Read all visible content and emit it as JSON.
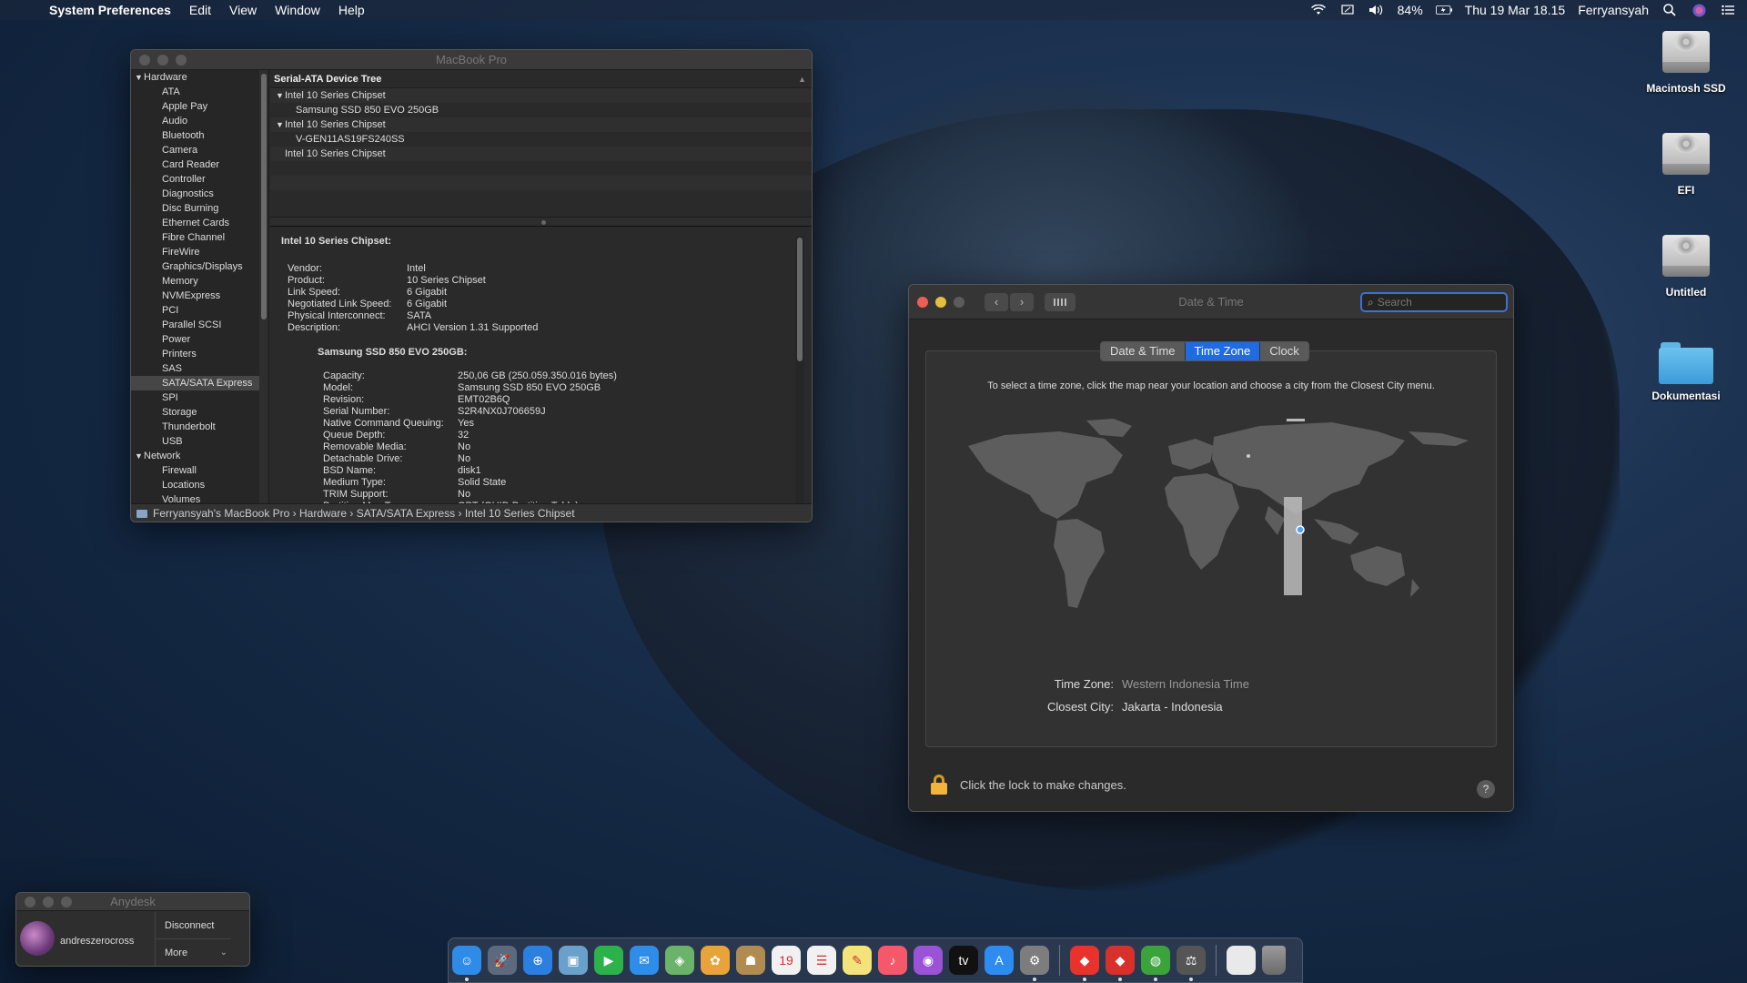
{
  "menubar": {
    "app_name": "System Preferences",
    "menus": [
      "Edit",
      "View",
      "Window",
      "Help"
    ],
    "battery": "84%",
    "clock": "Thu 19 Mar  18.15",
    "user": "Ferryansyah"
  },
  "sysinfo": {
    "title": "MacBook Pro",
    "sidebar": {
      "hardware_label": "Hardware",
      "hardware_items": [
        "ATA",
        "Apple Pay",
        "Audio",
        "Bluetooth",
        "Camera",
        "Card Reader",
        "Controller",
        "Diagnostics",
        "Disc Burning",
        "Ethernet Cards",
        "Fibre Channel",
        "FireWire",
        "Graphics/Displays",
        "Memory",
        "NVMExpress",
        "PCI",
        "Parallel SCSI",
        "Power",
        "Printers",
        "SAS",
        "SATA/SATA Express",
        "SPI",
        "Storage",
        "Thunderbolt",
        "USB"
      ],
      "selected": "SATA/SATA Express",
      "network_label": "Network",
      "network_items": [
        "Firewall",
        "Locations",
        "Volumes"
      ]
    },
    "tree_header": "Serial-ATA Device Tree",
    "devices": [
      {
        "label": "Intel 10 Series Chipset",
        "level": 0,
        "expanded": true
      },
      {
        "label": "Samsung SSD 850 EVO 250GB",
        "level": 1
      },
      {
        "label": "Intel 10 Series Chipset",
        "level": 0,
        "expanded": true
      },
      {
        "label": "V-GEN11AS19FS240SS",
        "level": 1
      },
      {
        "label": "Intel 10 Series Chipset",
        "level": 0
      }
    ],
    "detail": {
      "heading": "Intel 10 Series Chipset:",
      "props": [
        [
          "Vendor:",
          "Intel"
        ],
        [
          "Product:",
          "10 Series Chipset"
        ],
        [
          "Link Speed:",
          "6 Gigabit"
        ],
        [
          "Negotiated Link Speed:",
          "6 Gigabit"
        ],
        [
          "Physical Interconnect:",
          "SATA"
        ],
        [
          "Description:",
          "AHCI Version 1.31 Supported"
        ]
      ],
      "subheading": "Samsung SSD 850 EVO 250GB:",
      "sub_props": [
        [
          "Capacity:",
          "250,06 GB (250.059.350.016 bytes)"
        ],
        [
          "Model:",
          "Samsung SSD 850 EVO 250GB"
        ],
        [
          "Revision:",
          "EMT02B6Q"
        ],
        [
          "Serial Number:",
          "S2R4NX0J706659J"
        ],
        [
          "Native Command Queuing:",
          "Yes"
        ],
        [
          "Queue Depth:",
          "32"
        ],
        [
          "Removable Media:",
          "No"
        ],
        [
          "Detachable Drive:",
          "No"
        ],
        [
          "BSD Name:",
          "disk1"
        ],
        [
          "Medium Type:",
          "Solid State"
        ],
        [
          "TRIM Support:",
          "No"
        ],
        [
          "Partition Map Type:",
          "GPT (GUID Partition Table)"
        ]
      ]
    },
    "path": "Ferryansyah's MacBook Pro  ›  Hardware  ›  SATA/SATA Express  ›  Intel 10 Series Chipset"
  },
  "datetime": {
    "title": "Date & Time",
    "search_placeholder": "Search",
    "tabs": [
      {
        "label": "Date & Time",
        "active": false
      },
      {
        "label": "Time Zone",
        "active": true
      },
      {
        "label": "Clock",
        "active": false
      }
    ],
    "instructions": "To select a time zone, click the map near your location and choose a city from the Closest City menu.",
    "time_zone_label": "Time Zone:",
    "time_zone_value": "Western Indonesia Time",
    "closest_city_label": "Closest City:",
    "closest_city_value": "Jakarta - Indonesia",
    "lock_text": "Click the lock to make changes.",
    "help": "?"
  },
  "desktop_icons": [
    "Macintosh SSD",
    "EFI",
    "Untitled",
    "Dokumentasi"
  ],
  "anydesk": {
    "title": "Anydesk",
    "user": "andreszerocross",
    "disconnect": "Disconnect",
    "more": "More"
  },
  "dock": {
    "apps": [
      {
        "name": "finder-icon",
        "glyph": "☺",
        "color": "#2f8be8",
        "running": true
      },
      {
        "name": "launchpad-icon",
        "glyph": "🚀",
        "color": "#5d6a7e",
        "running": false
      },
      {
        "name": "safari-icon",
        "glyph": "⊕",
        "color": "#2a7fe0",
        "running": false
      },
      {
        "name": "preview-icon",
        "glyph": "▣",
        "color": "#6aa0c9",
        "running": false
      },
      {
        "name": "facetime-icon",
        "glyph": "▶",
        "color": "#2bb34a",
        "running": false
      },
      {
        "name": "messages-icon",
        "glyph": "✉",
        "color": "#2d8de8",
        "running": false
      },
      {
        "name": "maps-icon",
        "glyph": "◈",
        "color": "#6cb36a",
        "running": false
      },
      {
        "name": "photos-icon",
        "glyph": "✿",
        "color": "#e8a33a",
        "running": false
      },
      {
        "name": "contacts-icon",
        "glyph": "☗",
        "color": "#b08c52",
        "running": false
      },
      {
        "name": "calendar-icon",
        "glyph": "19",
        "color": "#f1f1f1",
        "running": false
      },
      {
        "name": "reminders-icon",
        "glyph": "☰",
        "color": "#f1f1f1",
        "running": false
      },
      {
        "name": "notes-icon",
        "glyph": "✎",
        "color": "#f4e27a",
        "running": false
      },
      {
        "name": "music-icon",
        "glyph": "♪",
        "color": "#f5586b",
        "running": false
      },
      {
        "name": "podcasts-icon",
        "glyph": "◉",
        "color": "#9b52d6",
        "running": false
      },
      {
        "name": "tv-icon",
        "glyph": "tv",
        "color": "#111111",
        "running": false
      },
      {
        "name": "app-store-icon",
        "glyph": "A",
        "color": "#2e8cf0",
        "running": false
      },
      {
        "name": "system-preferences-icon",
        "glyph": "⚙",
        "color": "#7d7d7d",
        "running": true
      },
      {
        "name": "anydesk-icon",
        "glyph": "◆",
        "color": "#e8322b",
        "running": true
      },
      {
        "name": "anydesk-alt-icon",
        "glyph": "◆",
        "color": "#d8302a",
        "running": true
      },
      {
        "name": "globe-app-icon",
        "glyph": "◍",
        "color": "#3aa43a",
        "running": true
      },
      {
        "name": "hanger-app-icon",
        "glyph": "⚖",
        "color": "#555555",
        "running": true
      }
    ]
  }
}
